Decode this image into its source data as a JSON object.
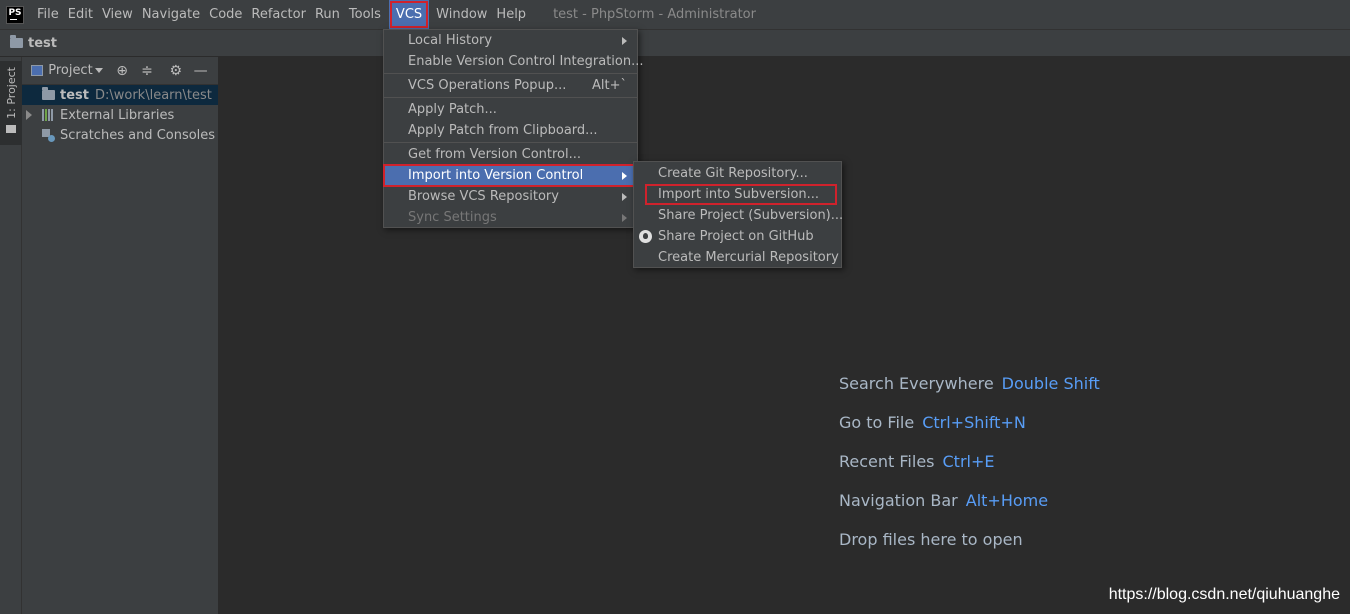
{
  "menubar": {
    "logo_text": "PS",
    "items": [
      "File",
      "Edit",
      "View",
      "Navigate",
      "Code",
      "Refactor",
      "Run",
      "Tools",
      "VCS",
      "Window",
      "Help"
    ],
    "window_title": "test - PhpStorm - Administrator"
  },
  "navbar": {
    "project": "test"
  },
  "toolstrip": {
    "tab_label": "1: Project"
  },
  "project_panel": {
    "title": "Project",
    "tree": [
      {
        "label": "test",
        "path": "D:\\work\\learn\\test"
      },
      {
        "label": "External Libraries"
      },
      {
        "label": "Scratches and Consoles"
      }
    ]
  },
  "vcs_menu": {
    "items": [
      {
        "label": "Local History",
        "submenu": true
      },
      {
        "label": "Enable Version Control Integration..."
      },
      {
        "label": "VCS Operations Popup...",
        "shortcut": "Alt+`"
      },
      {
        "label": "Apply Patch..."
      },
      {
        "label": "Apply Patch from Clipboard..."
      },
      {
        "label": "Get from Version Control..."
      },
      {
        "label": "Import into Version Control",
        "submenu": true,
        "highlighted": true
      },
      {
        "label": "Browse VCS Repository",
        "submenu": true
      },
      {
        "label": "Sync Settings",
        "submenu": true,
        "disabled": true
      }
    ]
  },
  "import_submenu": {
    "items": [
      {
        "label": "Create Git Repository..."
      },
      {
        "label": "Import into Subversion..."
      },
      {
        "label": "Share Project (Subversion)..."
      },
      {
        "label": "Share Project on GitHub",
        "icon": "github-icon"
      },
      {
        "label": "Create Mercurial Repository"
      }
    ]
  },
  "editor_hints": [
    {
      "text": "Search Everywhere",
      "key": "Double Shift"
    },
    {
      "text": "Go to File",
      "key": "Ctrl+Shift+N"
    },
    {
      "text": "Recent Files",
      "key": "Ctrl+E"
    },
    {
      "text": "Navigation Bar",
      "key": "Alt+Home"
    },
    {
      "text": "Drop files here to open",
      "key": ""
    }
  ],
  "watermark": "https://blog.csdn.net/qiuhuanghe",
  "colors": {
    "accent": "#4b6eaf",
    "highlight_box": "#d0222c",
    "key_hint": "#589df6"
  }
}
